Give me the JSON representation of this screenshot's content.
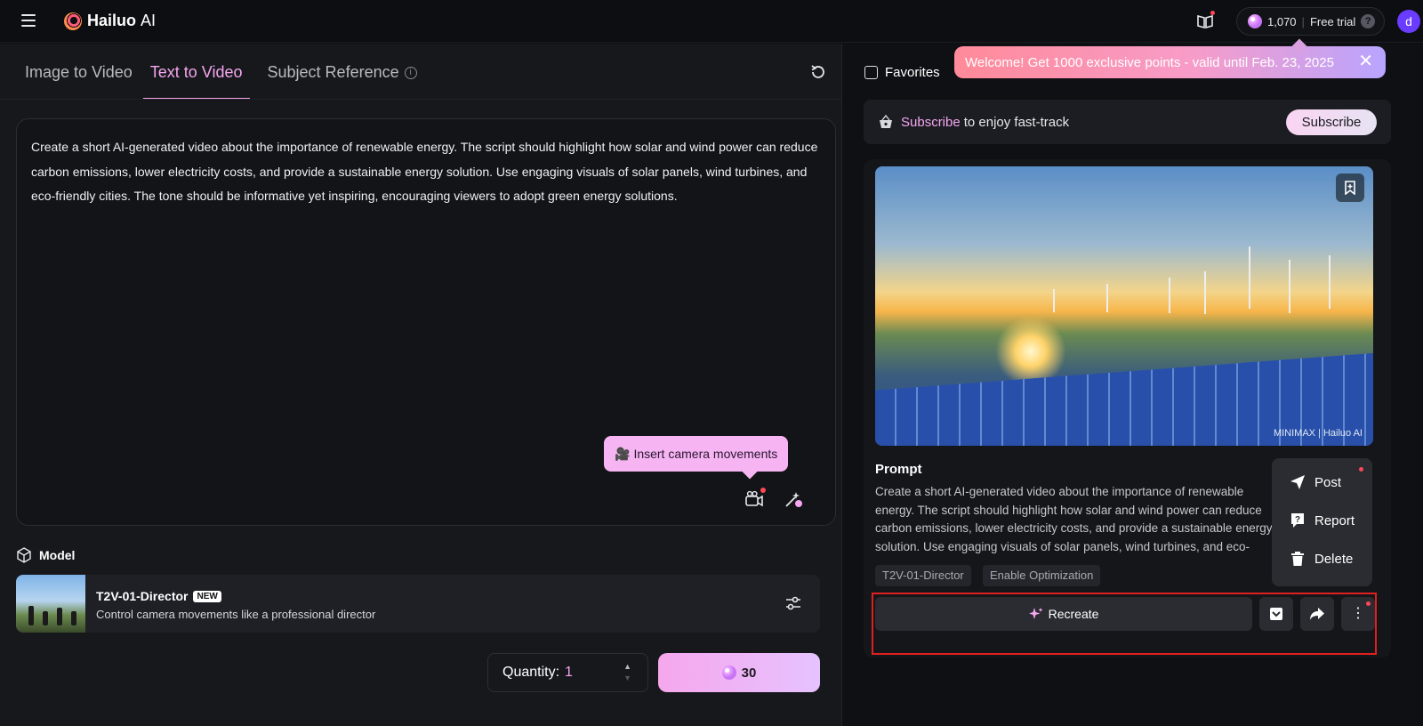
{
  "app": {
    "name": "Hailuo",
    "name_suffix": "AI"
  },
  "header": {
    "points": "1,070",
    "plan": "Free trial",
    "help": "?",
    "avatar_initial": "d"
  },
  "tabs": [
    {
      "label": "Image to Video",
      "active": false
    },
    {
      "label": "Text to Video",
      "active": true
    },
    {
      "label": "Subject Reference",
      "active": false
    }
  ],
  "prompt_input": {
    "value": "Create a short AI-generated video about the importance of renewable energy. The script should highlight how solar and wind power can reduce carbon emissions, lower electricity costs, and provide a sustainable energy solution. Use engaging visuals of solar panels, wind turbines, and eco-friendly cities. The tone should be informative yet inspiring, encouraging viewers to adopt green energy solutions."
  },
  "tooltip": {
    "label": "Insert camera movements"
  },
  "model": {
    "section_label": "Model",
    "name": "T2V-01-Director",
    "badge": "NEW",
    "description": "Control camera movements like a professional director"
  },
  "generate": {
    "quantity_label": "Quantity:",
    "quantity_value": "1",
    "cost": "30"
  },
  "right": {
    "favorites_label": "Favorites",
    "toast": "Welcome! Get 1000 exclusive points - valid until Feb. 23, 2025",
    "subscribe_bar": {
      "highlight": "Subscribe",
      "rest": "to enjoy fast-track",
      "button": "Subscribe"
    },
    "watermark": "MINIMAX | Hailuo AI",
    "card": {
      "prompt_heading": "Prompt",
      "prompt_text": "Create a short AI-generated video about the importance of renewable energy. The script should highlight how solar and wind power can reduce carbon emissions, lower electricity costs, and provide a sustainable energy solution. Use engaging visuals of solar panels, wind turbines, and eco-friendly cities. The tone should be informative yet inspiring, encouraging viewers to adopt green energy solutions.",
      "tags": [
        "T2V-01-Director",
        "Enable Optimization"
      ],
      "recreate_label": "Recreate"
    },
    "menu": [
      {
        "label": "Post",
        "icon": "send-icon"
      },
      {
        "label": "Report",
        "icon": "report-icon"
      },
      {
        "label": "Delete",
        "icon": "trash-icon"
      }
    ]
  },
  "colors": {
    "accent": "#f5a6f0",
    "notification": "#ff4757",
    "highlight_frame": "#e02020"
  }
}
